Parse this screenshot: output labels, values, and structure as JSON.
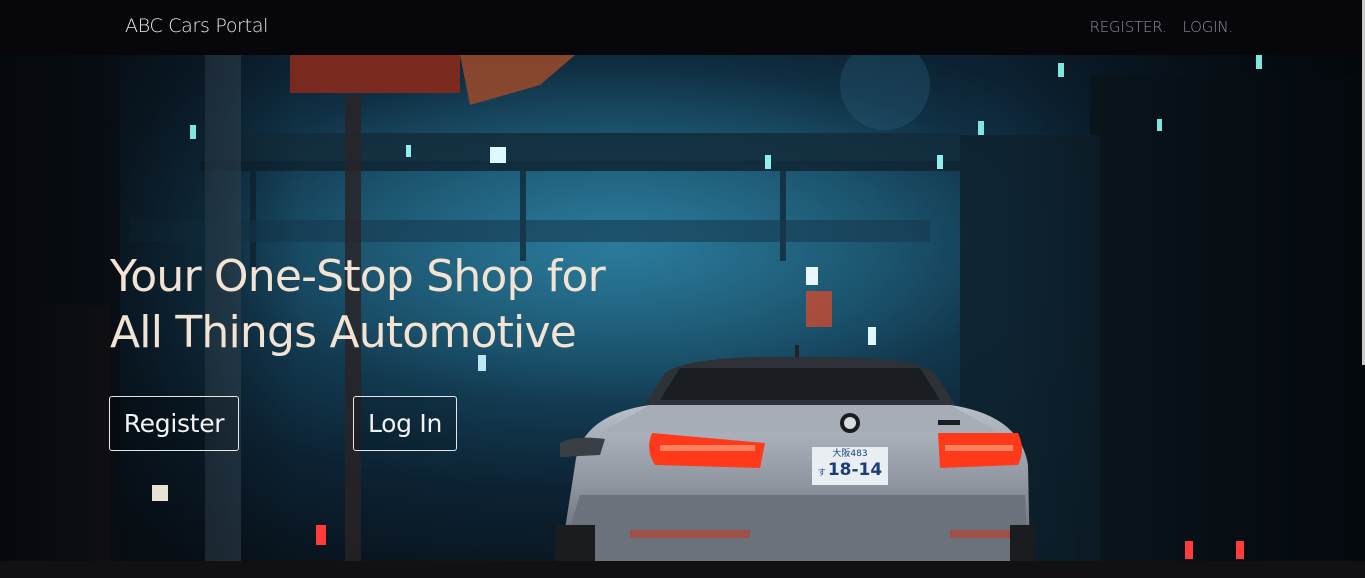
{
  "navbar": {
    "brand": "ABC Cars Portal",
    "links": [
      {
        "label": "REGISTER."
      },
      {
        "label": "LOGIN."
      }
    ]
  },
  "hero": {
    "headline_line1": "Your One-Stop Shop for",
    "headline_line2": "All Things Automotive",
    "register_button": "Register",
    "login_button": "Log In",
    "license_plate": {
      "top": "大阪483",
      "main": "18-14",
      "prefix": "す"
    }
  },
  "colors": {
    "navbar_bg": "#07070b",
    "headline": "#f3e3d3",
    "taillight": "#ff3a1a"
  }
}
